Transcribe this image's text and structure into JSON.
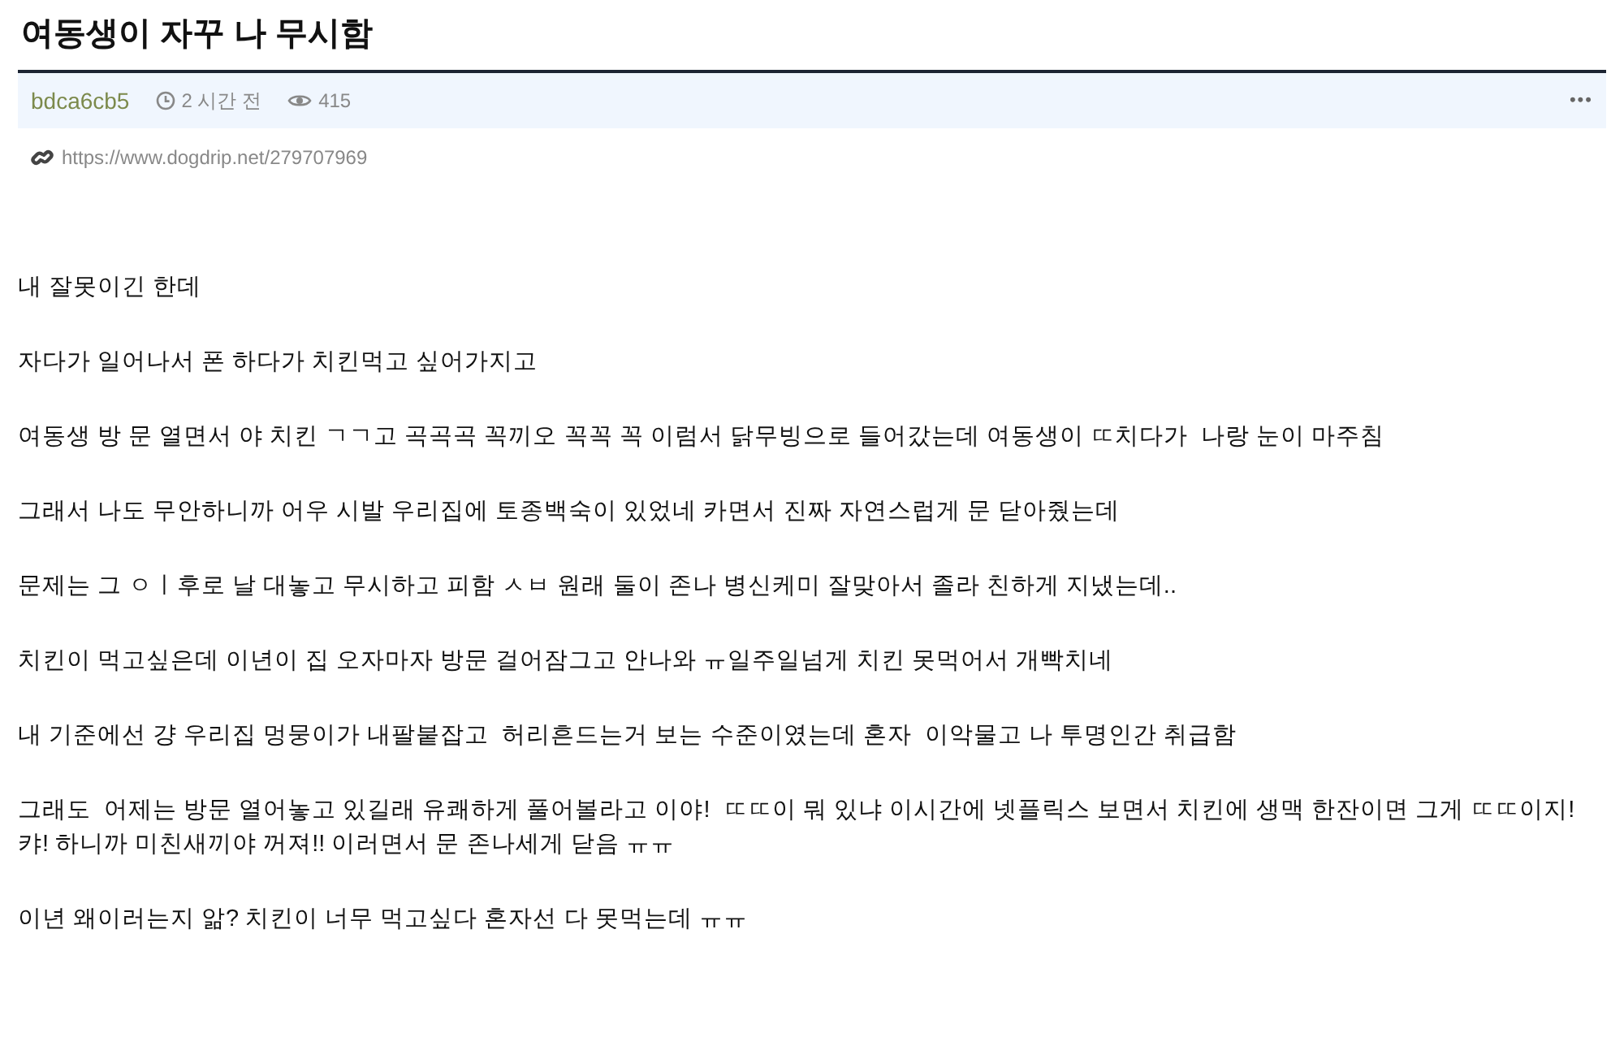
{
  "post": {
    "title": "여동생이 자꾸 나 무시함",
    "author": "bdca6cb5",
    "time": "2 시간 전",
    "views": "415",
    "more": "•••",
    "url": "https://www.dogdrip.net/279707969"
  },
  "body": [
    "내 잘못이긴 한데",
    "자다가 일어나서 폰 하다가 치킨먹고 싶어가지고",
    "여동생 방 문 열면서 야 치킨 ㄱㄱ고 곡곡곡 꼭끼오 꼭꼭 꼭 이럼서 닭무빙으로 들어갔는데 여동생이 ㄸ치다가  나랑 눈이 마주침",
    "그래서 나도 무안하니까 어우 시발 우리집에 토종백숙이 있었네 카면서 진짜 자연스럽게 문 닫아줬는데",
    "문제는 그 ㅇㅣ후로 날 대놓고 무시하고 피함 ㅅㅂ 원래 둘이 존나 병신케미 잘맞아서 졸라 친하게 지냈는데..",
    "치킨이 먹고싶은데 이년이 집 오자마자 방문 걸어잠그고 안나와 ㅠ일주일넘게 치킨 못먹어서 개빡치네",
    "내 기준에선 걍 우리집 멍뭉이가 내팔붙잡고  허리흔드는거 보는 수준이였는데 혼자  이악물고 나 투명인간 취급함",
    "그래도  어제는 방문 열어놓고 있길래 유쾌하게 풀어볼라고 이야!  ㄸㄸ이 뭐 있냐 이시간에 넷플릭스 보면서 치킨에 생맥 한잔이면 그게 ㄸㄸ이지!\n캬! 하니까 미친새끼야 꺼져!! 이러면서 문 존나세게 닫음 ㅠㅠ",
    "이년 왜이러는지 앎? 치킨이 너무 먹고싶다 혼자선 다 못먹는데 ㅠㅠ"
  ]
}
